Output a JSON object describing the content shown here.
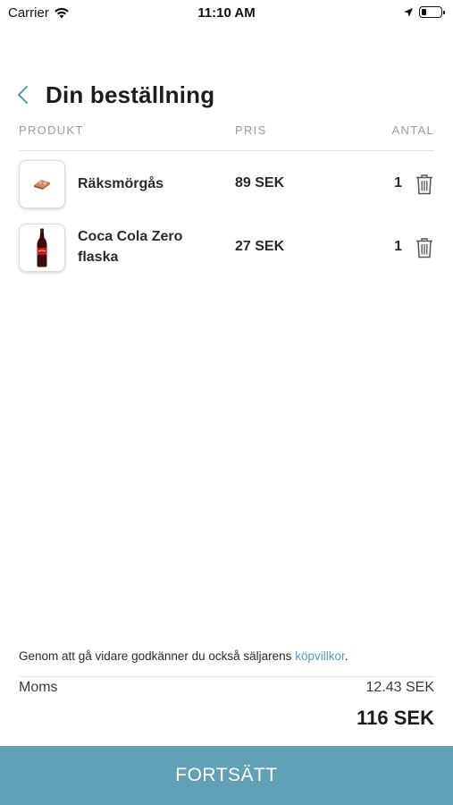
{
  "status_bar": {
    "carrier": "Carrier",
    "time": "11:10 AM"
  },
  "header": {
    "title": "Din beställning"
  },
  "columns": {
    "product": "PRODUKT",
    "price": "PRIS",
    "quantity": "ANTAL"
  },
  "items": [
    {
      "name": "Räksmörgås",
      "price": "89 SEK",
      "quantity": "1",
      "icon": "shrimp-sandwich-image"
    },
    {
      "name": "Coca Cola Zero flaska",
      "price": "27 SEK",
      "quantity": "1",
      "icon": "cola-bottle-image"
    }
  ],
  "footer": {
    "terms_text": "Genom att gå vidare godkänner du också säljarens ",
    "terms_link": "köpvillkor",
    "terms_end": ".",
    "moms_label": "Moms",
    "moms_value": "12.43 SEK",
    "total": "116 SEK",
    "cta_label": "FORTSÄTT"
  },
  "colors": {
    "accent": "#62a0b8",
    "link": "#5b9bb4",
    "back_arrow": "#5b9bb4"
  }
}
